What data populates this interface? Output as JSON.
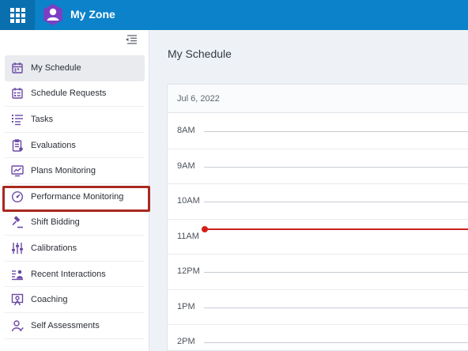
{
  "header": {
    "app_title": "My Zone",
    "colors": {
      "bar": "#0b82c9",
      "apps_button": "#0a6fae",
      "logo": "#7b3fc4"
    }
  },
  "sidebar": {
    "items": [
      {
        "label": "My Schedule",
        "icon": "schedule-icon",
        "active": true
      },
      {
        "label": "Schedule Requests",
        "icon": "schedule-requests-icon"
      },
      {
        "label": "Tasks",
        "icon": "tasks-icon"
      },
      {
        "label": "Evaluations",
        "icon": "evaluations-icon"
      },
      {
        "label": "Plans Monitoring",
        "icon": "plans-monitoring-icon"
      },
      {
        "label": "Performance Monitoring",
        "icon": "performance-gauge-icon",
        "highlighted": true
      },
      {
        "label": "Shift Bidding",
        "icon": "gavel-icon"
      },
      {
        "label": "Calibrations",
        "icon": "sliders-icon"
      },
      {
        "label": "Recent Interactions",
        "icon": "recent-interactions-icon"
      },
      {
        "label": "Coaching",
        "icon": "coaching-icon"
      },
      {
        "label": "Self Assessments",
        "icon": "self-assessment-icon"
      }
    ],
    "colors": {
      "icon": "#6b4aa6",
      "highlight_box": "#a8291f"
    }
  },
  "main": {
    "page_title": "My Schedule",
    "calendar": {
      "date": "Jul 6, 2022",
      "hours": [
        "8AM",
        "9AM",
        "10AM",
        "11AM",
        "12PM",
        "1PM",
        "2PM"
      ],
      "now_indicator_color": "#c8211b"
    }
  }
}
